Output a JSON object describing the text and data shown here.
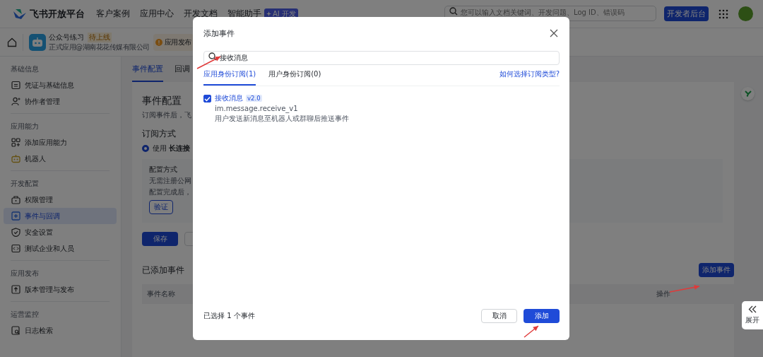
{
  "header": {
    "logo_text": "飞书开放平台",
    "nav": [
      {
        "label": "客户案例"
      },
      {
        "label": "应用中心"
      },
      {
        "label": "开发文档"
      },
      {
        "label": "智能助手",
        "badge": "AI 开发"
      }
    ],
    "search": {
      "placeholder": "您可以输入文档关键词、开发问题、Log ID、错误码"
    },
    "console_button": "开发者后台"
  },
  "app_bar": {
    "app_name": "公众号练习",
    "status": "待上线",
    "subtitle": "正式应用@湖南花花传媒有限公司",
    "notice": "应用发布"
  },
  "sidebar": {
    "sections": [
      {
        "title": "基础信息",
        "items": [
          {
            "label": "凭证与基础信息",
            "selected": false
          },
          {
            "label": "协作者管理",
            "selected": false
          }
        ]
      },
      {
        "title": "应用能力",
        "items": [
          {
            "label": "添加应用能力",
            "selected": false
          },
          {
            "label": "机器人",
            "selected": false
          }
        ]
      },
      {
        "title": "开发配置",
        "items": [
          {
            "label": "权限管理",
            "selected": false
          },
          {
            "label": "事件与回调",
            "selected": true
          },
          {
            "label": "安全设置",
            "selected": false
          },
          {
            "label": "测试企业和人员",
            "selected": false
          }
        ]
      },
      {
        "title": "应用发布",
        "items": [
          {
            "label": "版本管理与发布",
            "selected": false
          }
        ]
      },
      {
        "title": "运营监控",
        "items": [
          {
            "label": "日志检索",
            "selected": false
          }
        ]
      }
    ]
  },
  "main": {
    "tabs": [
      {
        "label": "事件配置",
        "selected": true
      },
      {
        "label": "回调",
        "selected": false
      }
    ],
    "title": "事件配置",
    "description": "订阅事件后，飞",
    "subscription": {
      "heading": "订阅方式",
      "option": {
        "text": "使用 **长连接**",
        "selected": true
      },
      "config": {
        "title": "配置方式",
        "lines": [
          "无需注册公网",
          "配置完成后，"
        ],
        "verify_button": "验证"
      }
    },
    "save_button": "保存",
    "added_events": {
      "heading": "已添加事件",
      "add_button": "添加事件",
      "columns": [
        "事件名称",
        "操作"
      ]
    }
  },
  "side_toggle": {
    "label": "展开"
  },
  "dialog": {
    "title": "添加事件",
    "search": {
      "value": "接收消息"
    },
    "tabs": [
      {
        "label": "应用身份订阅(1)",
        "selected": true
      },
      {
        "label": "用户身份订阅(0)",
        "selected": false
      }
    ],
    "help_link": "如何选择订阅类型?",
    "events": [
      {
        "name": "接收消息",
        "version": "v2.0",
        "id": "im.message.receive_v1",
        "description": "用户发送新消息至机器人或群聊后推送事件",
        "checked": true
      }
    ],
    "summary": "已选择 1 个事件",
    "cancel_button": "取消",
    "confirm_button": "添加"
  }
}
